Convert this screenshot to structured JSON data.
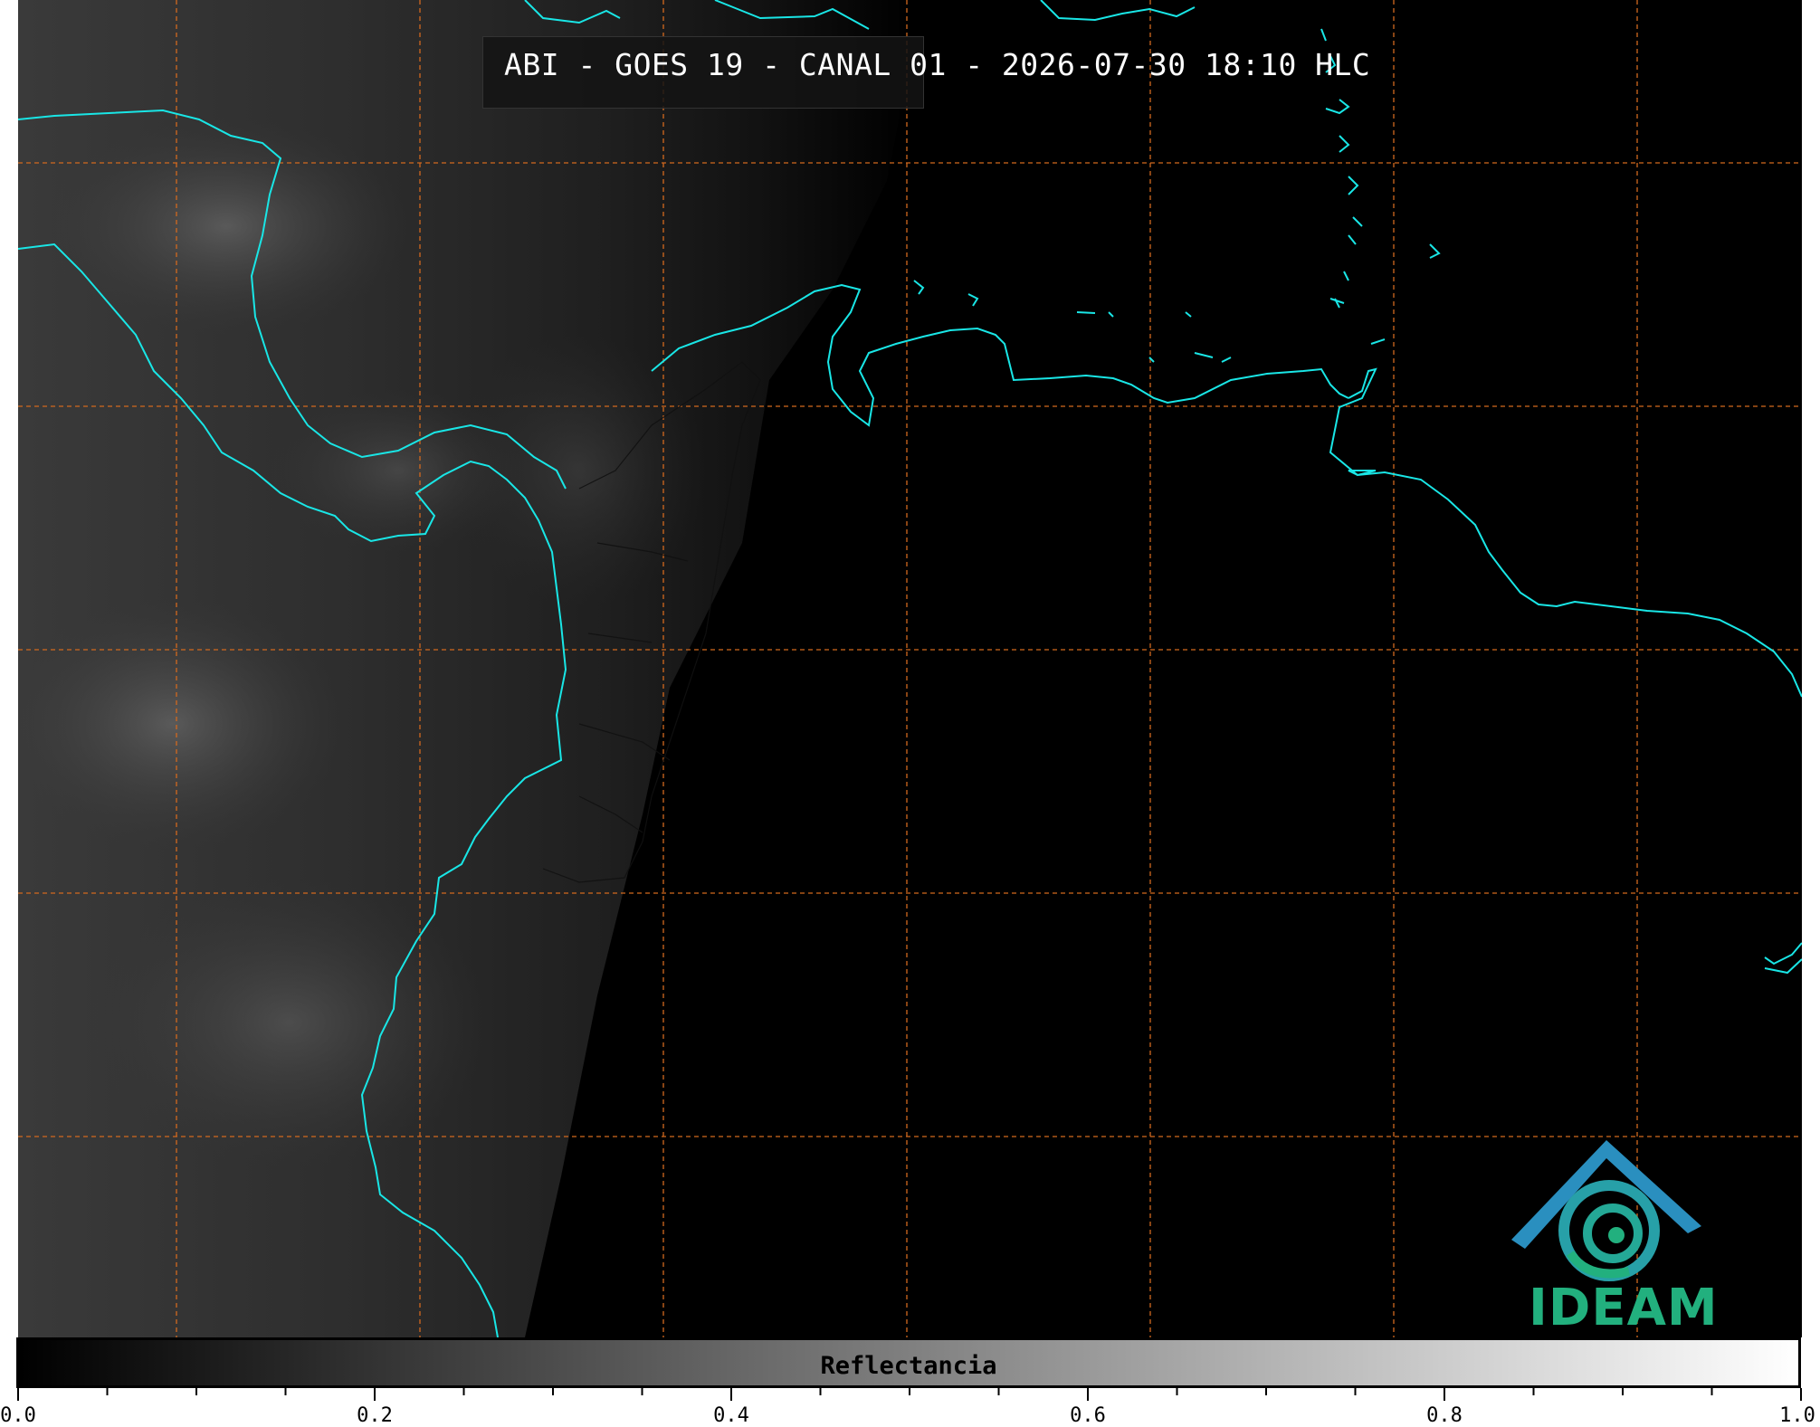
{
  "title": "ABI - GOES 19 - CANAL 01 - 2026-07-30 18:10 HLC",
  "logo_text": "IDEAM",
  "colorbar": {
    "label": "Reflectancia",
    "range": [
      0.0,
      1.0
    ],
    "tick_labels": [
      "0.0",
      "0.2",
      "0.4",
      "0.6",
      "0.8",
      "1.0"
    ],
    "colormap_start": "#000000",
    "colormap_end": "#ffffff"
  },
  "colors": {
    "coastline": "#19e6e6",
    "gridline": "#d2691e",
    "background": "#000000",
    "logo_text": "#22b07e",
    "logo_mark": "#2a8fbf"
  }
}
